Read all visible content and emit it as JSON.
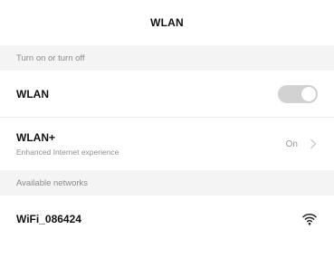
{
  "header": {
    "title": "WLAN"
  },
  "sections": {
    "toggle_header": "Turn on or turn off",
    "networks_header": "Available networks"
  },
  "wlan_row": {
    "label": "WLAN",
    "toggle_state": "on"
  },
  "wlan_plus_row": {
    "label": "WLAN+",
    "subtitle": "Enhanced Internet experience",
    "value": "On",
    "icon": "chevron-right-icon"
  },
  "networks": [
    {
      "ssid": "WiFi_086424",
      "icon": "wifi-signal-icon"
    }
  ],
  "colors": {
    "toggle_track": "#d2d2d2",
    "section_background": "#f4f4f4",
    "secondary_text": "#8a8a8a"
  }
}
